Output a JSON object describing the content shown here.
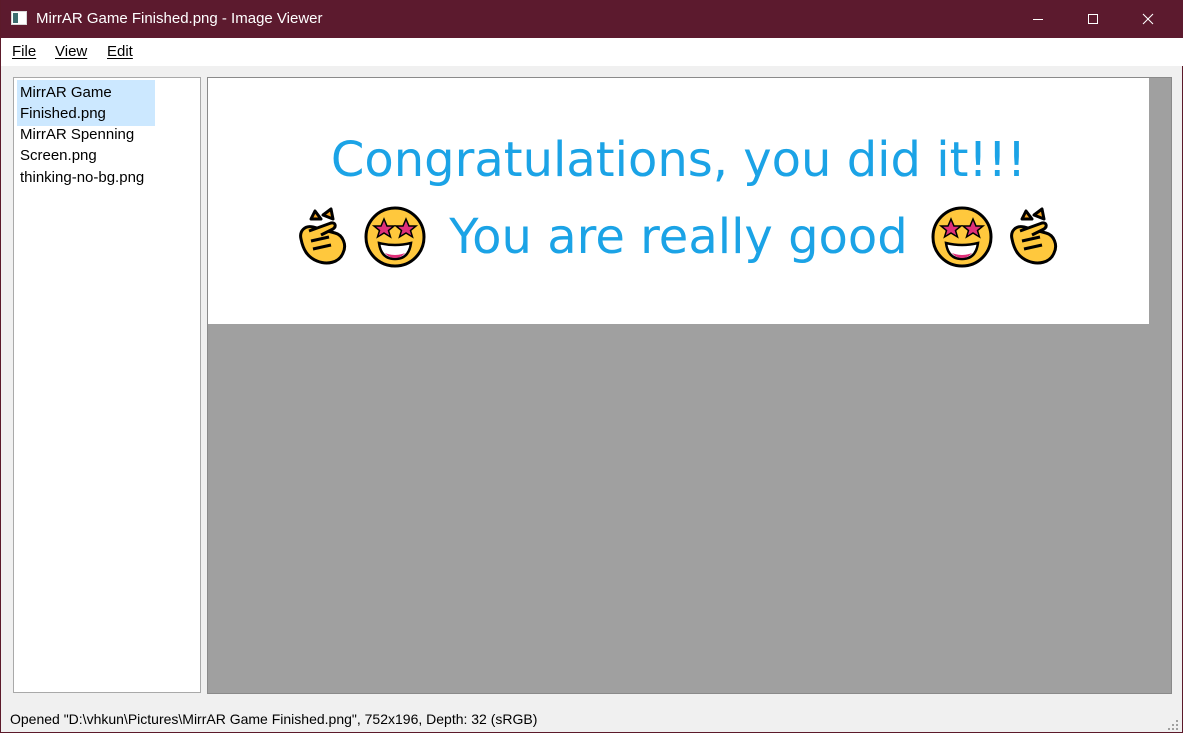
{
  "window": {
    "title": "MirrAR Game Finished.png - Image Viewer",
    "titlebar_color": "#5c1a2e"
  },
  "menu": {
    "file": "File",
    "view": "View",
    "edit": "Edit"
  },
  "file_list": {
    "items": [
      {
        "label": "MirrAR Game Finished.png",
        "selected": true
      },
      {
        "label": "MirrAR Spenning Screen.png",
        "selected": false
      },
      {
        "label": "thinking-no-bg.png",
        "selected": false
      }
    ],
    "selection_color": "#cce8ff"
  },
  "image": {
    "line1": "Congratulations, you did it!!!",
    "line2": "You are really good",
    "text_color": "#1ba3e6",
    "icons": [
      "clapping-hands-icon",
      "star-struck-icon",
      "star-struck-icon",
      "clapping-hands-icon"
    ]
  },
  "status": {
    "text": "Opened \"D:\\vhkun\\Pictures\\MirrAR Game Finished.png\", 752x196, Depth: 32 (sRGB)"
  }
}
